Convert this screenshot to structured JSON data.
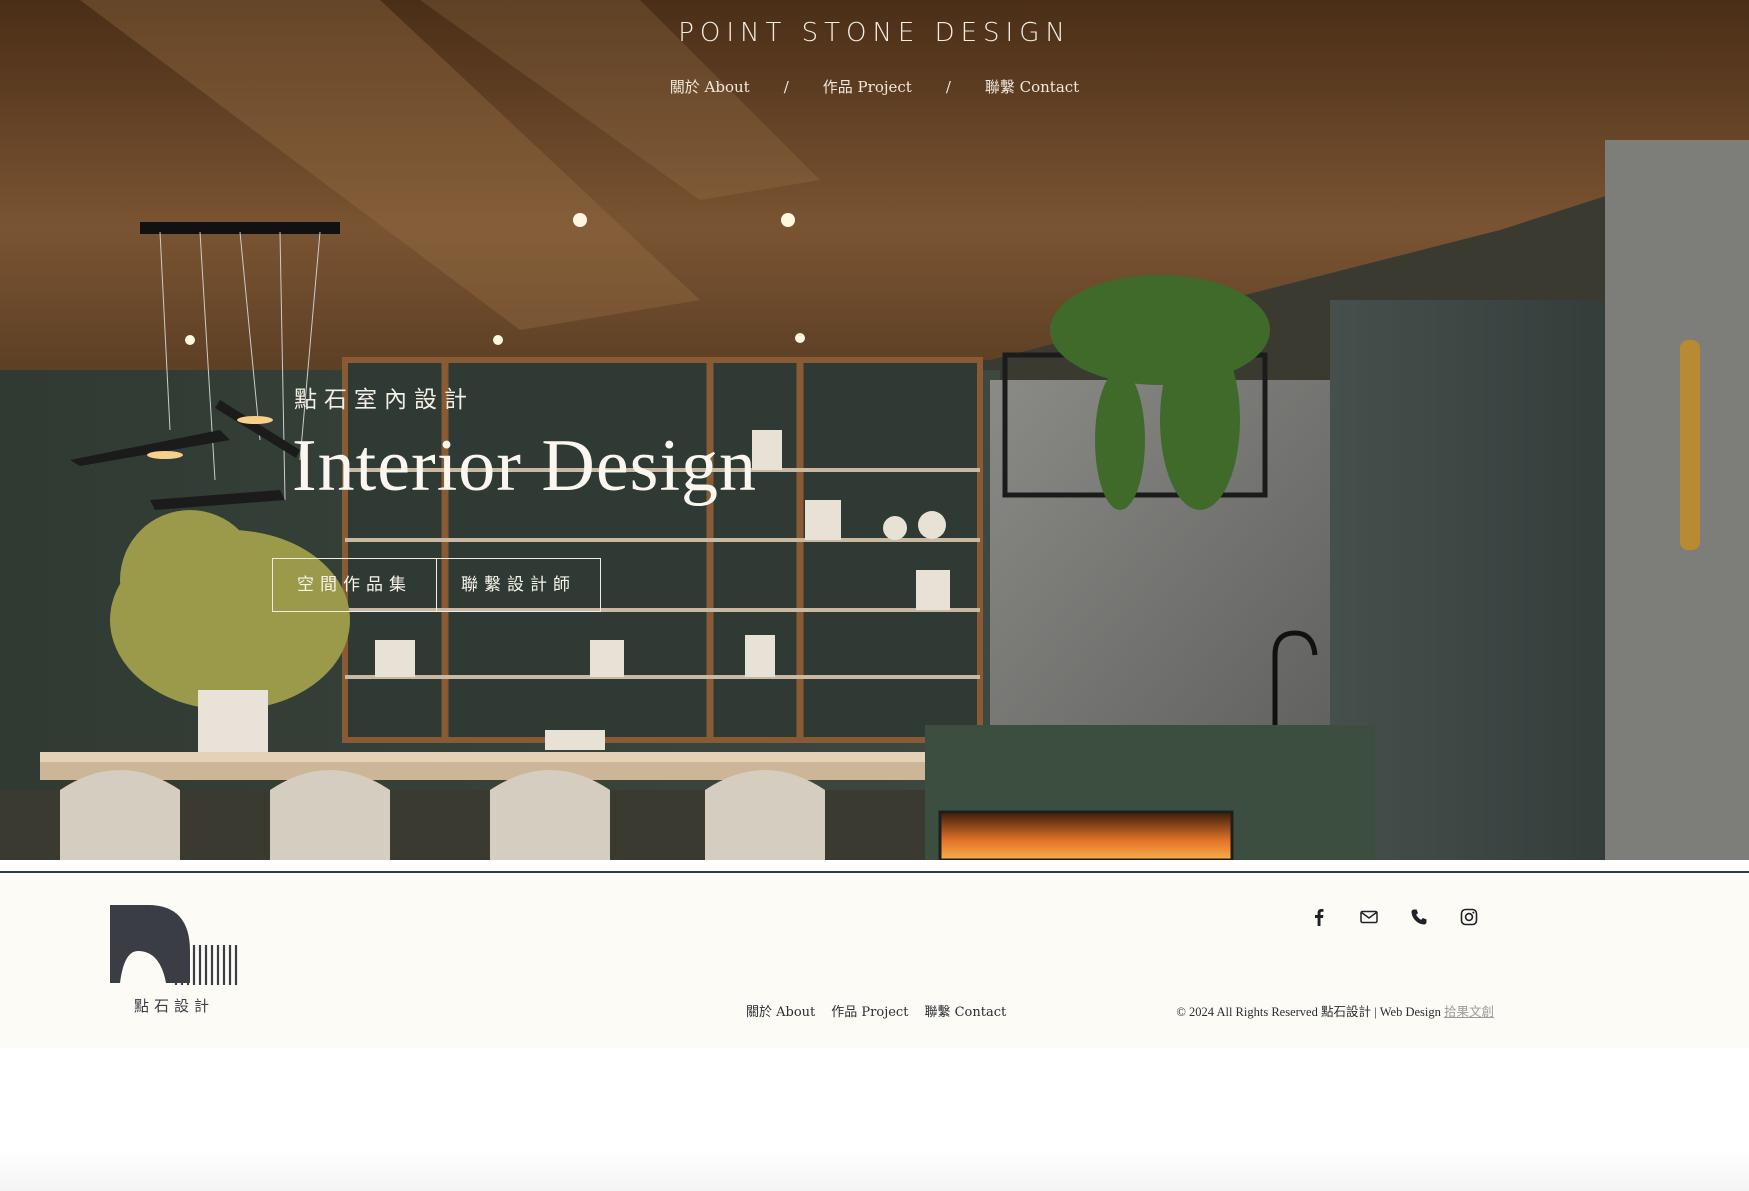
{
  "header": {
    "brand": "POINT STONE DESIGN",
    "nav": [
      {
        "label": "關於 About"
      },
      {
        "label": "作品 Project"
      },
      {
        "label": "聯繫 Contact"
      }
    ],
    "separator": "/"
  },
  "hero": {
    "subtitle": "點石室內設計",
    "title": "Interior Design",
    "buttons": [
      {
        "label": "空間作品集"
      },
      {
        "label": "聯繫設計師"
      }
    ]
  },
  "footer": {
    "logo_text": "點石設計",
    "social": [
      "facebook-icon",
      "mail-icon",
      "phone-icon",
      "instagram-icon"
    ],
    "nav": [
      {
        "label": "關於 About"
      },
      {
        "label": "作品 Project"
      },
      {
        "label": "聯繫 Contact"
      }
    ],
    "copyright": "© 2024 All Rights Reserved 點石設計 | Web Design ",
    "credit_link": "拾果文創"
  },
  "colors": {
    "footer_bg": "#fdfbf5",
    "logo_dark": "#3a3d44",
    "hero_text": "#f5efe4"
  }
}
